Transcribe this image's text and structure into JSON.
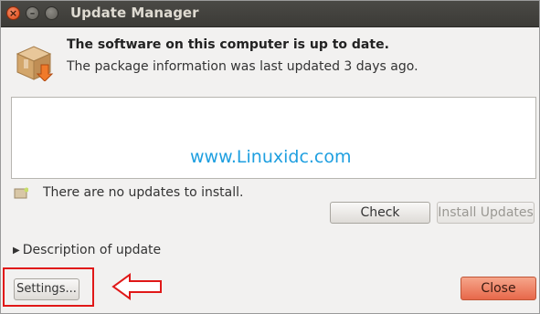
{
  "window": {
    "title": "Update Manager",
    "controls": [
      "close-icon",
      "minimize-icon",
      "maximize-icon"
    ]
  },
  "status": {
    "headline": "The software on this computer is up to date.",
    "subline": "The package information was last updated 3 days ago.",
    "no_updates": "There are no updates to install."
  },
  "watermark": "www.Linuxidc.com",
  "buttons": {
    "check": "Check",
    "install_updates": "Install Updates",
    "settings": "Settings...",
    "close": "Close"
  },
  "expander": {
    "label": "Description of update"
  },
  "colors": {
    "titlebar": "#3c3b37",
    "close_button": "#e7684a",
    "highlight": "#e01818",
    "watermark": "#1e9fe0"
  }
}
